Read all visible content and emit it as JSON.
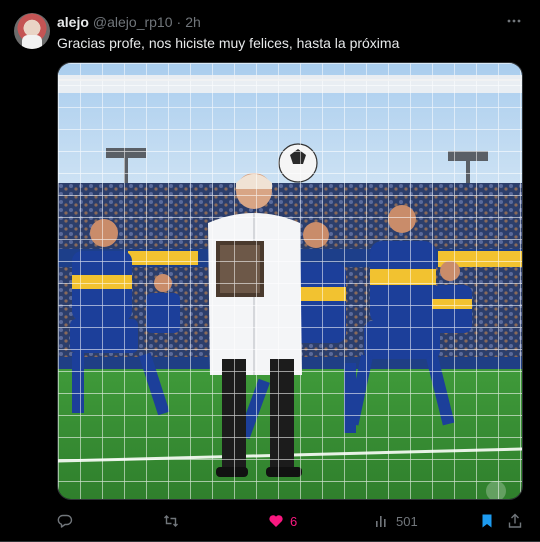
{
  "post": {
    "author_name": "alejo",
    "author_handle": "@alejo_rp10",
    "separator": "·",
    "timestamp": "2h",
    "text": "Gracias profe, nos hiciste muy felices, hasta la próxima",
    "image_alt": "Hombre con guardapolvo blanco y libros parado frente al arco entre jugadores de azul y amarillo"
  },
  "actions": {
    "reply_count": "",
    "repost_count": "",
    "like_count": "6",
    "like_active": true,
    "views_count": "501",
    "bookmarked": true
  },
  "icons": {
    "more": "more-horizontal-icon",
    "reply": "reply-icon",
    "repost": "repost-icon",
    "like": "heart-icon",
    "views": "views-chart-icon",
    "bookmark": "bookmark-icon",
    "share": "share-icon"
  },
  "colors": {
    "background": "#000000",
    "text": "#e7e9ea",
    "muted": "#71767b",
    "like": "#f91880",
    "accent": "#1d9bf0"
  }
}
